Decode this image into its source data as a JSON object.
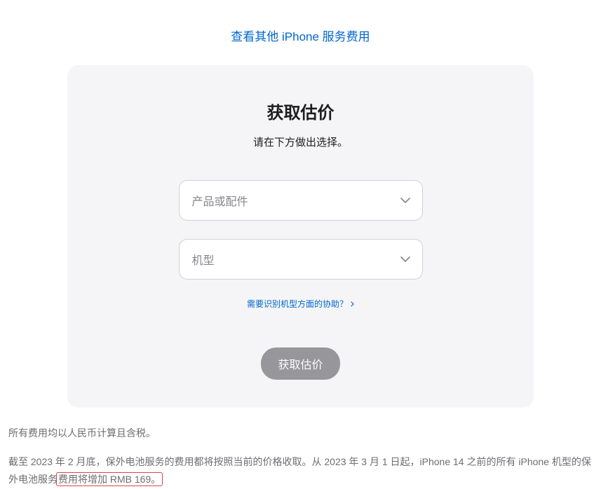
{
  "topLink": {
    "label": "查看其他 iPhone 服务费用"
  },
  "card": {
    "title": "获取估价",
    "subtitle": "请在下方做出选择。",
    "productSelect": {
      "placeholder": "产品或配件"
    },
    "modelSelect": {
      "placeholder": "机型"
    },
    "helpLink": {
      "label": "需要识别机型方面的协助？"
    },
    "submitButton": {
      "label": "获取估价"
    }
  },
  "footer": {
    "line1": "所有费用均以人民币计算且含税。",
    "line2_part1": "截至 2023 年 2 月底，保外电池服务的费用都将按照当前的价格收取。从 2023 年 3 月 1 日起，iPhone 14 之前的所有 iPhone 机型的保外电池服务",
    "line2_highlight": "费用将增加 RMB 169。"
  }
}
